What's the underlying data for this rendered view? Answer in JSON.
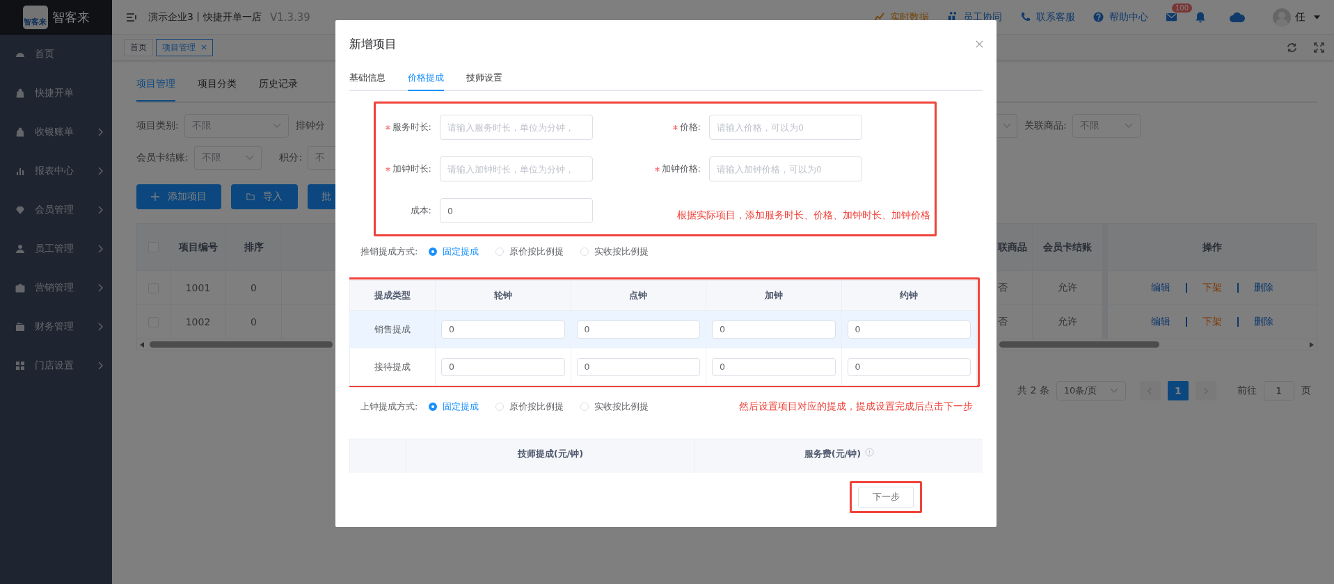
{
  "sidebar": {
    "logo_mark": "智客来",
    "brand": "智客来",
    "items": [
      {
        "label": "首页",
        "kind": "gauge",
        "expandable": false
      },
      {
        "label": "快捷开单",
        "kind": "bag",
        "expandable": false
      },
      {
        "label": "收银账单",
        "kind": "bag",
        "expandable": true
      },
      {
        "label": "报表中心",
        "kind": "chart",
        "expandable": true
      },
      {
        "label": "会员管理",
        "kind": "diamond",
        "expandable": true
      },
      {
        "label": "员工管理",
        "kind": "person",
        "expandable": true
      },
      {
        "label": "营销管理",
        "kind": "briefcase",
        "expandable": true
      },
      {
        "label": "财务管理",
        "kind": "wallet",
        "expandable": true
      },
      {
        "label": "门店设置",
        "kind": "grid",
        "expandable": true
      }
    ]
  },
  "header": {
    "title": "演示企业3丨快捷开单一店",
    "version": "V1.3.39",
    "links": [
      {
        "label": "实时数据",
        "kind": "trend"
      },
      {
        "label": "员工协同",
        "kind": "people"
      },
      {
        "label": "联系客服",
        "kind": "phone"
      },
      {
        "label": "帮助中心",
        "kind": "help"
      }
    ],
    "mail_count": "100",
    "user": "任"
  },
  "page_tabs": [
    {
      "label": "首页",
      "selected": false,
      "closable": false
    },
    {
      "label": "项目管理",
      "selected": true,
      "closable": true
    }
  ],
  "content_tabs": [
    {
      "label": "项目管理",
      "selected": true
    },
    {
      "label": "项目分类",
      "selected": false
    },
    {
      "label": "历史记录",
      "selected": false
    }
  ],
  "filters": {
    "category": {
      "label": "项目类别:",
      "placeholder": "不限"
    },
    "group_label": "排钟分",
    "goods": {
      "label": "关联商品:",
      "placeholder": "不限"
    },
    "card": {
      "label": "会员卡结账:",
      "placeholder": "不限"
    },
    "points": {
      "label": "积分:",
      "placeholder": "不"
    }
  },
  "actions": [
    {
      "label": "添加项目",
      "kind": "add"
    },
    {
      "label": "导入",
      "kind": "import"
    },
    {
      "label": "批",
      "kind": "plain"
    }
  ],
  "table": {
    "all_checked": false,
    "columns_left": [
      "项目编号",
      "排序"
    ],
    "columns_right": [
      "联商品",
      "会员卡结账",
      "操作"
    ],
    "rows": [
      {
        "checked": false,
        "code": "1001",
        "order": "0",
        "goods": "否",
        "card": "允许",
        "ops": [
          {
            "label": "编辑",
            "kind": "link"
          },
          {
            "label": "下架",
            "kind": "warn"
          },
          {
            "label": "删除",
            "kind": "link"
          }
        ]
      },
      {
        "checked": false,
        "code": "1002",
        "order": "0",
        "goods": "否",
        "card": "允许",
        "ops": [
          {
            "label": "编辑",
            "kind": "link"
          },
          {
            "label": "下架",
            "kind": "warn"
          },
          {
            "label": "删除",
            "kind": "link"
          }
        ]
      }
    ]
  },
  "pagination": {
    "total": "共 2 条",
    "page_size": "10条/页",
    "pages": [
      {
        "label": "1",
        "selected": true
      }
    ],
    "goto_label": "前往",
    "goto_value": "1",
    "goto_unit": "页"
  },
  "dialog": {
    "title": "新增项目",
    "tabs": [
      {
        "label": "基础信息",
        "selected": false
      },
      {
        "label": "价格提成",
        "selected": true
      },
      {
        "label": "技师设置",
        "selected": false
      }
    ],
    "fields": [
      {
        "label": "服务时长:",
        "required": true,
        "placeholder": "请输入服务时长，单位为分钟，"
      },
      {
        "label": "价格:",
        "required": true,
        "placeholder": "请输入价格，可以为0"
      },
      {
        "label": "加钟时长:",
        "required": true,
        "placeholder": "请输入加钟时长，单位为分钟，"
      },
      {
        "label": "加钟价格:",
        "required": true,
        "placeholder": "请输入加钟价格，可以为0"
      },
      {
        "label": "成本:",
        "required": false,
        "value": "0"
      }
    ],
    "note_fields": "根据实际项目，添加服务时长、价格、加钟时长、加钟价格",
    "sales_mode": {
      "label": "推销提成方式:",
      "options": [
        {
          "label": "固定提成",
          "selected": true
        },
        {
          "label": "原价按比例提",
          "selected": false
        },
        {
          "label": "实收按比例提",
          "selected": false
        }
      ]
    },
    "commission": {
      "columns": [
        "提成类型",
        "轮钟",
        "点钟",
        "加钟",
        "约钟"
      ],
      "rows": [
        {
          "type": "销售提成",
          "highlighted": true,
          "values": [
            "0",
            "0",
            "0",
            "0"
          ]
        },
        {
          "type": "接待提成",
          "highlighted": false,
          "values": [
            "0",
            "0",
            "0",
            "0"
          ]
        }
      ]
    },
    "service_mode": {
      "label": "上钟提成方式:",
      "options": [
        {
          "label": "固定提成",
          "selected": true
        },
        {
          "label": "原价按比例提",
          "selected": false
        },
        {
          "label": "实收按比例提",
          "selected": false
        }
      ]
    },
    "note_commission": "然后设置项目对应的提成，提成设置完成后点击下一步",
    "tech_table": {
      "columns": [
        "技师提成(元/钟)",
        "服务费(元/钟)"
      ]
    },
    "next_button": "下一步"
  }
}
